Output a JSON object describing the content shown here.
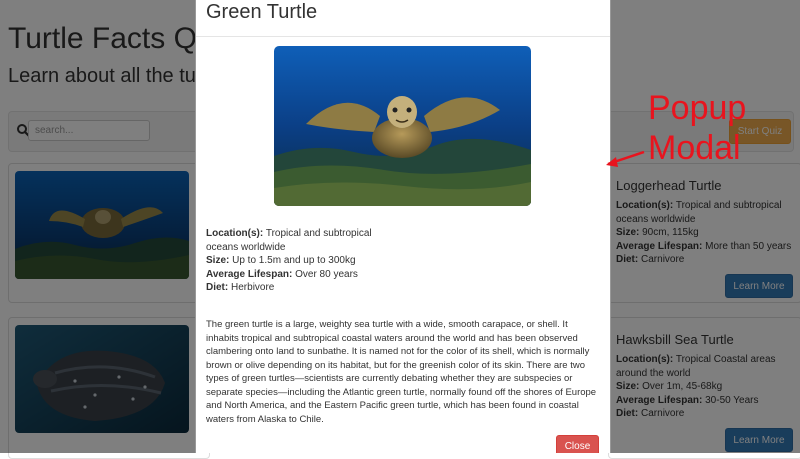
{
  "page": {
    "title": "Turtle Facts Quiz",
    "subtitle": "Learn about all the turtles"
  },
  "toolbar": {
    "search_placeholder": "search...",
    "start_quiz_label": "Start Quiz",
    "search_icon": "search-icon"
  },
  "cards": [
    {
      "title": "Loggerhead Turtle",
      "location_label": "Location(s):",
      "location": "Tropical and subtropical oceans worldwide",
      "size_label": "Size:",
      "size": "90cm, 115kg",
      "lifespan_label": "Average Lifespan:",
      "lifespan": "More than 50 years",
      "diet_label": "Diet:",
      "diet": "Carnivore",
      "button_label": "Learn More"
    },
    {
      "title": "Hawksbill Sea Turtle",
      "location_label": "Location(s):",
      "location": "Tropical Coastal areas around the world",
      "size_label": "Size:",
      "size": "Over 1m, 45-68kg",
      "lifespan_label": "Average Lifespan:",
      "lifespan": "30-50 Years",
      "diet_label": "Diet:",
      "diet": "Carnivore",
      "button_label": "Learn More"
    }
  ],
  "modal": {
    "title": "Green Turtle",
    "location_label": "Location(s):",
    "location": "Tropical and subtropical oceans worldwide",
    "size_label": "Size:",
    "size": "Up to 1.5m and up to 300kg",
    "lifespan_label": "Average Lifespan:",
    "lifespan": "Over 80 years",
    "diet_label": "Diet:",
    "diet": "Herbivore",
    "description": "The green turtle is a large, weighty sea turtle with a wide, smooth carapace, or shell. It inhabits tropical and subtropical coastal waters around the world and has been observed clambering onto land to sunbathe. It is named not for the color of its shell, which is normally brown or olive depending on its habitat, but for the greenish color of its skin. There are two types of green turtles—scientists are currently debating whether they are subspecies or separate species—including the Atlantic green turtle, normally found off the shores of Europe and North America, and the Eastern Pacific green turtle, which has been found in coastal waters from Alaska to Chile.",
    "close_label": "Close"
  },
  "annotation": {
    "line1": "Popup",
    "line2": "Modal",
    "color": "#e8141e"
  },
  "colors": {
    "primary": "#337ab7",
    "warning": "#f0ad4e",
    "danger": "#d9534f"
  }
}
